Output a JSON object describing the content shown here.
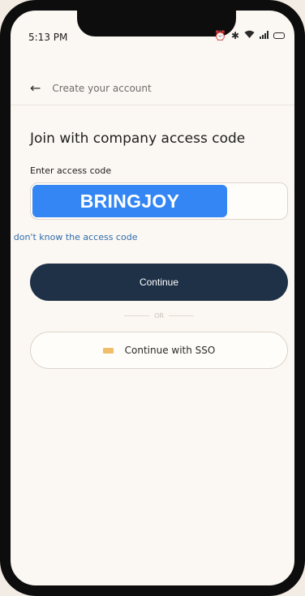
{
  "status_bar": {
    "time": "5:13 PM",
    "icons": [
      "alarm-icon",
      "bluetooth-icon",
      "wifi-icon",
      "signal-icon",
      "battery-icon"
    ]
  },
  "nav": {
    "back_icon": "back-arrow-icon",
    "title": "Create your account"
  },
  "main": {
    "heading": "Join with company access code",
    "field_label": "Enter access code",
    "access_code_value": "BRINGJOY",
    "help_link": "I don't know the access code",
    "continue_label": "Continue",
    "or_text": "OR",
    "sso_label": "Continue with SSO",
    "sso_icon": "card-icon"
  },
  "colors": {
    "primary_button": "#1f3147",
    "highlight": "#3386f3",
    "link": "#2f6db0",
    "sso_icon": "#f0be6a",
    "background": "#fbf7f2"
  }
}
